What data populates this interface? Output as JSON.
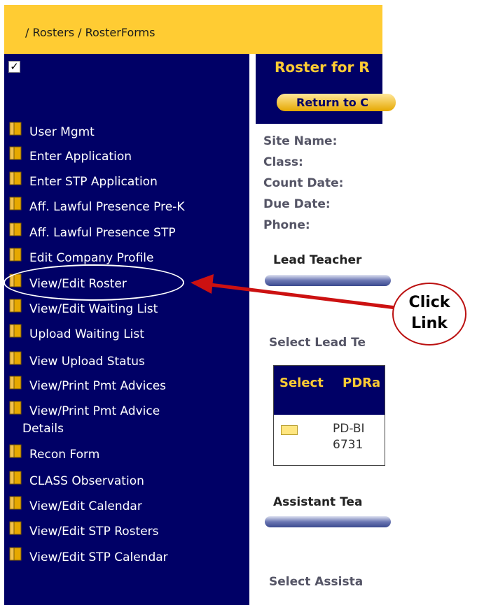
{
  "breadcrumb": "/ Rosters / RosterForms",
  "sidebar": {
    "items": [
      {
        "label": "User Mgmt"
      },
      {
        "label": "Enter Application"
      },
      {
        "label": "Enter STP Application"
      },
      {
        "label": "Aff. Lawful Presence Pre-K"
      },
      {
        "label": "Aff. Lawful Presence STP"
      },
      {
        "label": "Edit Company Profile"
      },
      {
        "label": "View/Edit Roster"
      },
      {
        "label": "View/Edit Waiting List"
      },
      {
        "label": "Upload Waiting List"
      },
      {
        "label": "View Upload Status"
      },
      {
        "label": "View/Print Pmt Advices"
      },
      {
        "label": "View/Print Pmt Advice",
        "label2": "Details"
      },
      {
        "label": "Recon Form"
      },
      {
        "label": "CLASS Observation"
      },
      {
        "label": "View/Edit Calendar"
      },
      {
        "label": "View/Edit STP Rosters"
      },
      {
        "label": "View/Edit STP Calendar"
      }
    ]
  },
  "main": {
    "title": "Roster for R",
    "return_button": "Return to C",
    "fields": [
      "Site Name:",
      "Class:",
      "Count Date:",
      "Due Date:",
      "Phone:"
    ],
    "lead_teacher": "Lead Teacher",
    "select_lead": "Select Lead Te",
    "table": {
      "headers": [
        "Select",
        "PDRa"
      ],
      "row": [
        "PD-BI",
        "6731"
      ]
    },
    "assistant_teacher": "Assistant Tea",
    "select_assistant": "Select Assista"
  },
  "callout": {
    "line1": "Click",
    "line2": "Link"
  },
  "colors": {
    "brand_navy": "#000066",
    "accent_yellow": "#ffcc33",
    "arrow_red": "#cc1111"
  }
}
